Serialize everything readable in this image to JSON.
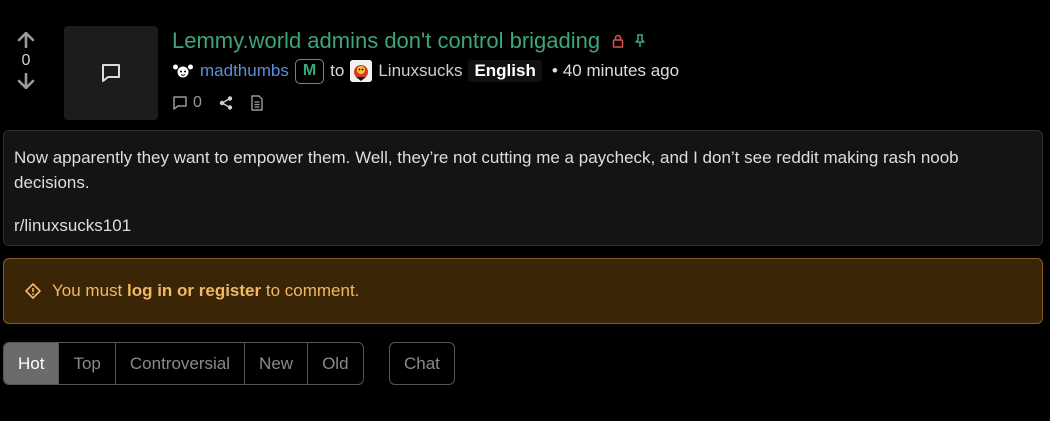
{
  "post": {
    "score": "0",
    "title": "Lemmy.world admins don't control brigading",
    "author": "madthumbs",
    "mod_badge": "M",
    "to_label": "to",
    "community": "Linuxsucks",
    "language": "English",
    "time_sep": "•",
    "time": "40 minutes ago",
    "comment_count": "0",
    "body": [
      "Now apparently they want to empower them. Well, they’re not cutting me a paycheck, and I don’t see reddit making rash noob decisions.",
      "r/linuxsucks101"
    ]
  },
  "alert": {
    "prefix": "You must",
    "link": "log in or register",
    "suffix": "to comment."
  },
  "sort": {
    "options": [
      "Hot",
      "Top",
      "Controversial",
      "New",
      "Old"
    ],
    "active": "Hot",
    "chat_label": "Chat"
  },
  "colors": {
    "title": "#3ea57a",
    "user": "#5d8fd9",
    "warning": "#f0b964",
    "lock": "#e05050"
  },
  "icons": [
    "arrow-up-icon",
    "arrow-down-icon",
    "comment-icon",
    "lock-icon",
    "pin-icon",
    "share-icon",
    "document-icon",
    "warning-icon"
  ]
}
